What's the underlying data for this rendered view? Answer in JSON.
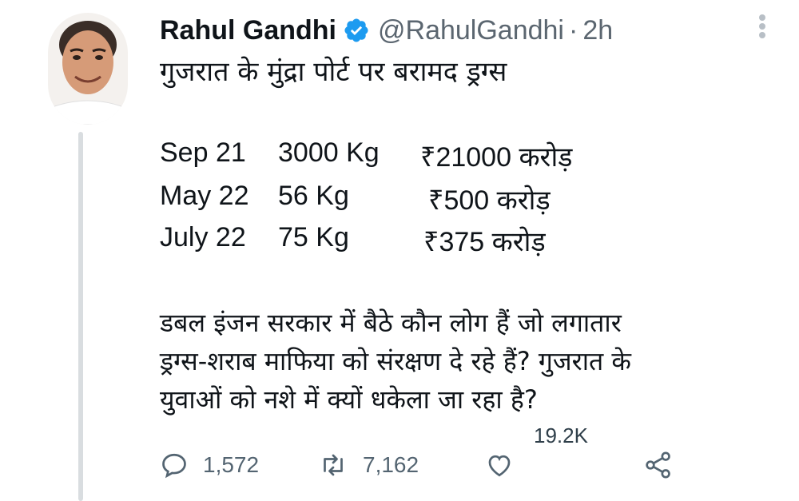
{
  "author": {
    "name": "Rahul Gandhi",
    "handle": "@RahulGandhi",
    "separator": "·",
    "time": "2h",
    "verified_color": "#1d9bf0"
  },
  "tweet": {
    "title": "गुजरात के मुंद्रा पोर्ट पर बरामद ड्रग्स",
    "rows": [
      {
        "date": "Sep 21",
        "qty": "3000 Kg",
        "value": "₹21000 करोड़"
      },
      {
        "date": "May 22",
        "qty": "56 Kg",
        "value": "₹500 करोड़"
      },
      {
        "date": "July 22",
        "qty": "75 Kg",
        "value": "₹375 करोड़"
      }
    ],
    "paragraph_lines": [
      "डबल इंजन सरकार में बैठे कौन लोग हैं जो लगातार",
      "ड्रग्स-शराब माफिया को संरक्षण दे रहे हैं? गुजरात के",
      "युवाओं को नशे में क्यों धकेला जा रहा है?"
    ]
  },
  "stats": {
    "views": "19.2K",
    "replies": "1,572",
    "retweets": "7,162"
  },
  "icons": {
    "reply": "reply-icon",
    "retweet": "retweet-icon",
    "like": "heart-icon",
    "share": "share-icon",
    "more": "more-vertical-icon",
    "verified": "verified-badge-icon"
  }
}
